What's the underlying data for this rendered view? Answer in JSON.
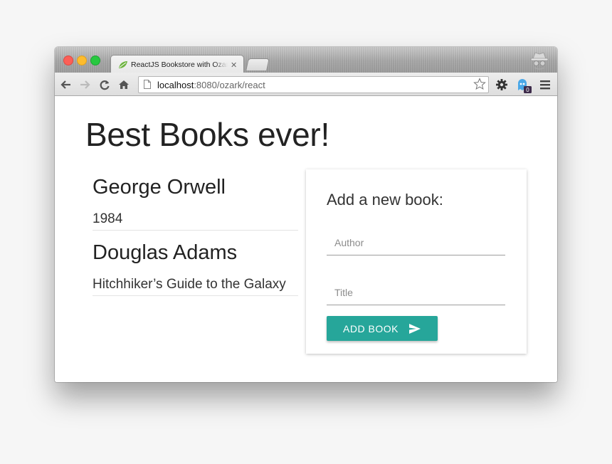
{
  "browser": {
    "tab_title": "ReactJS Bookstore with Ozark",
    "url_host": "localhost",
    "url_rest": ":8080/ozark/react",
    "extension_badge": "0"
  },
  "page": {
    "heading": "Best Books ever!",
    "books": [
      {
        "author": "George Orwell",
        "title": "1984"
      },
      {
        "author": "Douglas Adams",
        "title": "Hitchhiker’s Guide to the Galaxy"
      }
    ]
  },
  "form": {
    "heading": "Add a new book:",
    "author_placeholder": "Author",
    "title_placeholder": "Title",
    "submit_label": "ADD BOOK"
  },
  "colors": {
    "accent": "#26a69a",
    "text": "#222222"
  },
  "icons": [
    "spring-leaf-icon",
    "close-icon",
    "incognito-icon",
    "back-icon",
    "forward-icon",
    "reload-icon",
    "home-icon",
    "page-icon",
    "star-icon",
    "gear-icon",
    "ghost-extension-icon",
    "menu-icon",
    "send-icon"
  ]
}
